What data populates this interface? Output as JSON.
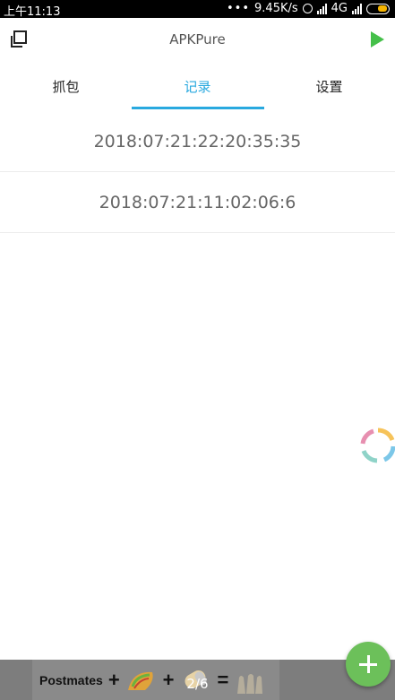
{
  "status_bar": {
    "time": "上午11:13",
    "network_speed": "9.45K/s",
    "network_type": "4G"
  },
  "app_bar": {
    "title": "APKPure"
  },
  "tabs": [
    {
      "label": "抓包",
      "active": false
    },
    {
      "label": "记录",
      "active": true
    },
    {
      "label": "设置",
      "active": false
    }
  ],
  "records": [
    {
      "label": "2018:07:21:22:20:35:35"
    },
    {
      "label": "2018:07:21:11:02:06:6"
    }
  ],
  "ad": {
    "brand": "Postmates",
    "plus": "+",
    "equals": "=",
    "page_counter": "2/6"
  },
  "colors": {
    "accent": "#29a9df",
    "fab": "#6cc05a",
    "play": "#45c04a"
  }
}
